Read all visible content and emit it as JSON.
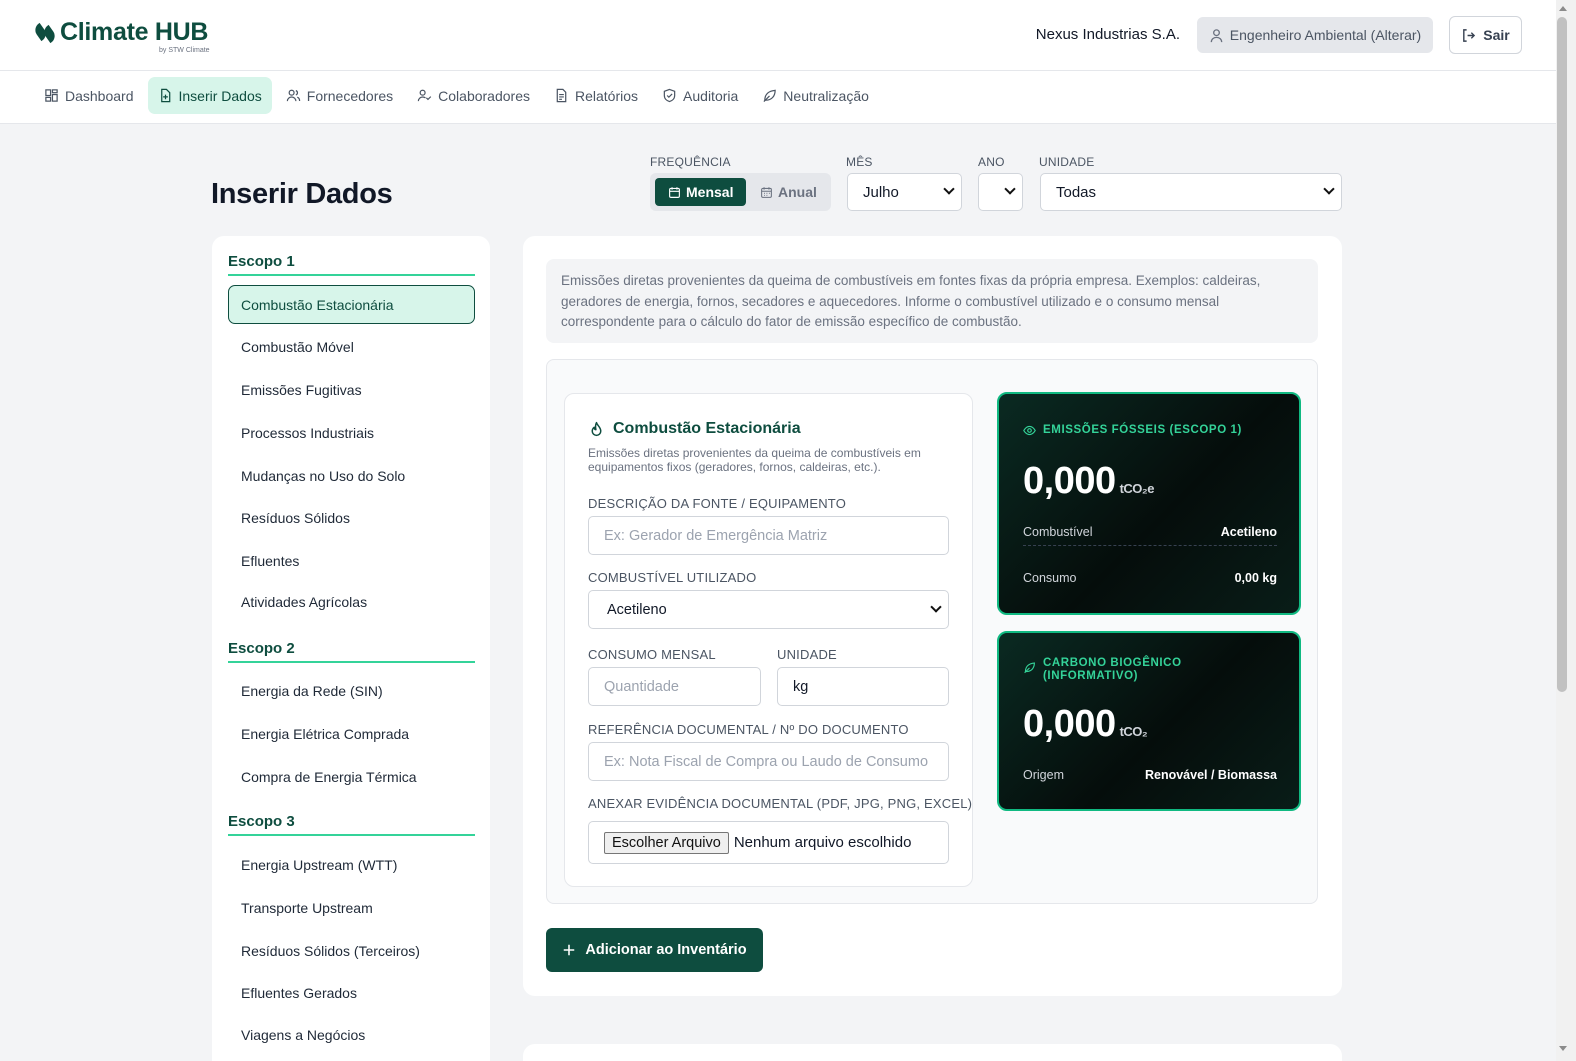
{
  "app": {
    "logo_text": "Climate HUB",
    "logo_sub": "by STW Climate",
    "company": "Nexus Industrias S.A.",
    "role": "Engenheiro Ambiental (Alterar)",
    "exit": "Sair",
    "brand_color": "#0e4d3f"
  },
  "nav": [
    {
      "label": "Dashboard",
      "icon": "grid-icon"
    },
    {
      "label": "Inserir Dados",
      "icon": "file-plus-icon",
      "active": true
    },
    {
      "label": "Fornecedores",
      "icon": "users-icon"
    },
    {
      "label": "Colaboradores",
      "icon": "user-check-icon"
    },
    {
      "label": "Relatórios",
      "icon": "document-icon"
    },
    {
      "label": "Auditoria",
      "icon": "shield-icon"
    },
    {
      "label": "Neutralização",
      "icon": "leaf-icon"
    }
  ],
  "page": {
    "title": "Inserir Dados",
    "frequency_label": "FREQUÊNCIA",
    "freq_monthly": "Mensal",
    "freq_annual": "Anual",
    "month_label": "MÊS",
    "month_value": "Julho",
    "year_label": "ANO",
    "year_value": "",
    "unit_label": "UNIDADE",
    "unit_value": "Todas"
  },
  "sidebar": {
    "scope1": {
      "title": "Escopo 1",
      "items": [
        "Combustão Estacionária",
        "Combustão Móvel",
        "Emissões Fugitivas",
        "Processos Industriais",
        "Mudanças no Uso do Solo",
        "Resíduos Sólidos",
        "Efluentes",
        "Atividades Agrícolas"
      ]
    },
    "scope2": {
      "title": "Escopo 2",
      "items": [
        "Energia da Rede (SIN)",
        "Energia Elétrica Comprada",
        "Compra de Energia Térmica"
      ]
    },
    "scope3": {
      "title": "Escopo 3",
      "items": [
        "Energia Upstream (WTT)",
        "Transporte Upstream",
        "Resíduos Sólidos (Terceiros)",
        "Efluentes Gerados",
        "Viagens a Negócios"
      ]
    }
  },
  "main": {
    "info": "Emissões diretas provenientes da queima de combustíveis em fontes fixas da própria empresa. Exemplos: caldeiras, geradores de energia, fornos, secadores e aquecedores. Informe o combustível utilizado e o consumo mensal correspondente para o cálculo do fator de emissão específico de combustão.",
    "form": {
      "title": "Combustão Estacionária",
      "desc": "Emissões diretas provenientes da queima de combustíveis em equipamentos fixos (geradores, fornos, caldeiras, etc.).",
      "source_label": "DESCRIÇÃO DA FONTE / EQUIPAMENTO",
      "source_placeholder": "Ex: Gerador de Emergência Matriz",
      "fuel_label": "COMBUSTÍVEL UTILIZADO",
      "fuel_value": "Acetileno",
      "consumption_label": "CONSUMO MENSAL",
      "consumption_placeholder": "Quantidade",
      "unit_label": "UNIDADE",
      "unit_value": "kg",
      "doc_label": "REFERÊNCIA DOCUMENTAL / Nº DO DOCUMENTO",
      "doc_placeholder": "Ex: Nota Fiscal de Compra ou Laudo de Consumo",
      "attach_label": "ANEXAR EVIDÊNCIA DOCUMENTAL (PDF, JPG, PNG, EXCEL)",
      "file_button": "Escolher Arquivo",
      "file_status": "Nenhum arquivo escolhido"
    },
    "fossil": {
      "title": "EMISSÕES FÓSSEIS (ESCOPO 1)",
      "value": "0,000",
      "unit": "tCO₂e",
      "fuel_key": "Combustível",
      "fuel_val": "Acetileno",
      "cons_key": "Consumo",
      "cons_val": "0,00 kg"
    },
    "biogenic": {
      "title": "CARBONO BIOGÊNICO (INFORMATIVO)",
      "value": "0,000",
      "unit": "tCO₂",
      "origin_key": "Origem",
      "origin_val": "Renovável / Biomassa"
    },
    "add_button": "Adicionar ao Inventário"
  }
}
